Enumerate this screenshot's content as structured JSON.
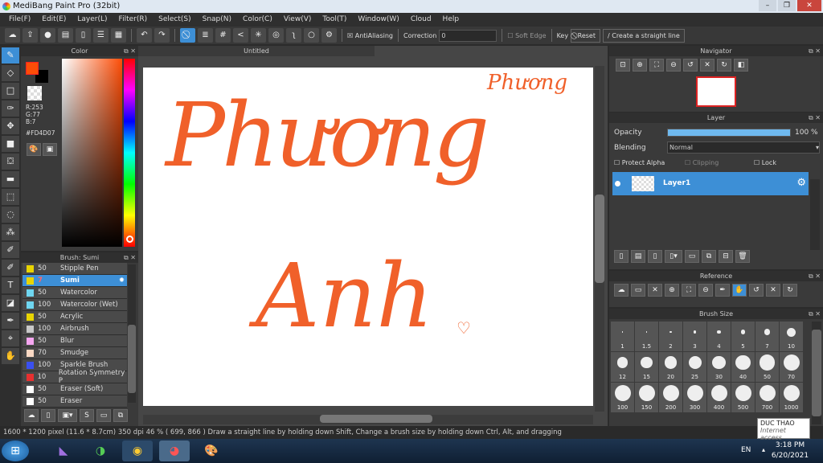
{
  "app": {
    "title": "MediBang Paint Pro (32bit)"
  },
  "menu": [
    "File(F)",
    "Edit(E)",
    "Layer(L)",
    "Filter(R)",
    "Select(S)",
    "Snap(N)",
    "Color(C)",
    "View(V)",
    "Tool(T)",
    "Window(W)",
    "Cloud",
    "Help"
  ],
  "toolbar": {
    "antialiasing": "AntiAliasing",
    "correction_label": "Correction",
    "correction_value": "0",
    "soft_edge": "Soft Edge",
    "key": "Key",
    "reset": "Reset",
    "straight_line": "Create a straight line"
  },
  "color_panel": {
    "title": "Color",
    "r": "R:253",
    "g": "G:77",
    "b": "B:7",
    "hex": "#FD4D07",
    "fg": "#FD4D07",
    "bg": "#000000"
  },
  "brush_panel": {
    "title": "Brush: Sumi",
    "items": [
      {
        "size": "50",
        "name": "Stipple Pen",
        "color": "#e8d400"
      },
      {
        "size": "7",
        "name": "Sumi",
        "color": "#e8d400",
        "selected": true
      },
      {
        "size": "50",
        "name": "Watercolor",
        "color": "#6fd6f0"
      },
      {
        "size": "100",
        "name": "Watercolor (Wet)",
        "color": "#6fd6f0"
      },
      {
        "size": "50",
        "name": "Acrylic",
        "color": "#e8d400"
      },
      {
        "size": "100",
        "name": "Airbrush",
        "color": "#c8c8c8"
      },
      {
        "size": "50",
        "name": "Blur",
        "color": "#f5a6f0"
      },
      {
        "size": "70",
        "name": "Smudge",
        "color": "#fbd9c4"
      },
      {
        "size": "100",
        "name": "Sparkle Brush",
        "color": "#3a50f0"
      },
      {
        "size": "10",
        "name": "Rotation Symmetry P",
        "color": "#e83030"
      },
      {
        "size": "50",
        "name": "Eraser (Soft)",
        "color": "#ffffff"
      },
      {
        "size": "50",
        "name": "Eraser",
        "color": "#ffffff"
      }
    ]
  },
  "document": {
    "tab": "Untitled",
    "drawing": {
      "small": "Phương",
      "line1": "Phương",
      "line2": "Anh"
    }
  },
  "navigator": {
    "title": "Navigator"
  },
  "layer_panel": {
    "title": "Layer",
    "opacity_label": "Opacity",
    "opacity_value": "100 %",
    "opacity": 100,
    "blending_label": "Blending",
    "blending_value": "Normal",
    "protect_alpha": "Protect Alpha",
    "clipping": "Clipping",
    "lock": "Lock",
    "layers": [
      {
        "name": "Layer1"
      }
    ]
  },
  "reference": {
    "title": "Reference"
  },
  "brush_size": {
    "title": "Brush Size",
    "sizes": [
      "1",
      "1.5",
      "2",
      "3",
      "4",
      "5",
      "7",
      "10",
      "12",
      "15",
      "20",
      "25",
      "30",
      "40",
      "50",
      "70",
      "100",
      "150",
      "200",
      "300",
      "400",
      "500",
      "700",
      "1000"
    ]
  },
  "status": {
    "text": "1600 * 1200 pixel   (11.6 * 8.7cm)   350 dpi   46 %   ( 699, 866 )   Draw a straight line by holding down Shift, Change a brush size by holding down Ctrl, Alt, and dragging"
  },
  "tooltip": {
    "name": "DUC THAO",
    "sub": "Internet access"
  },
  "taskbar": {
    "lang": "EN",
    "time": "3:18 PM",
    "date": "6/20/2021"
  }
}
